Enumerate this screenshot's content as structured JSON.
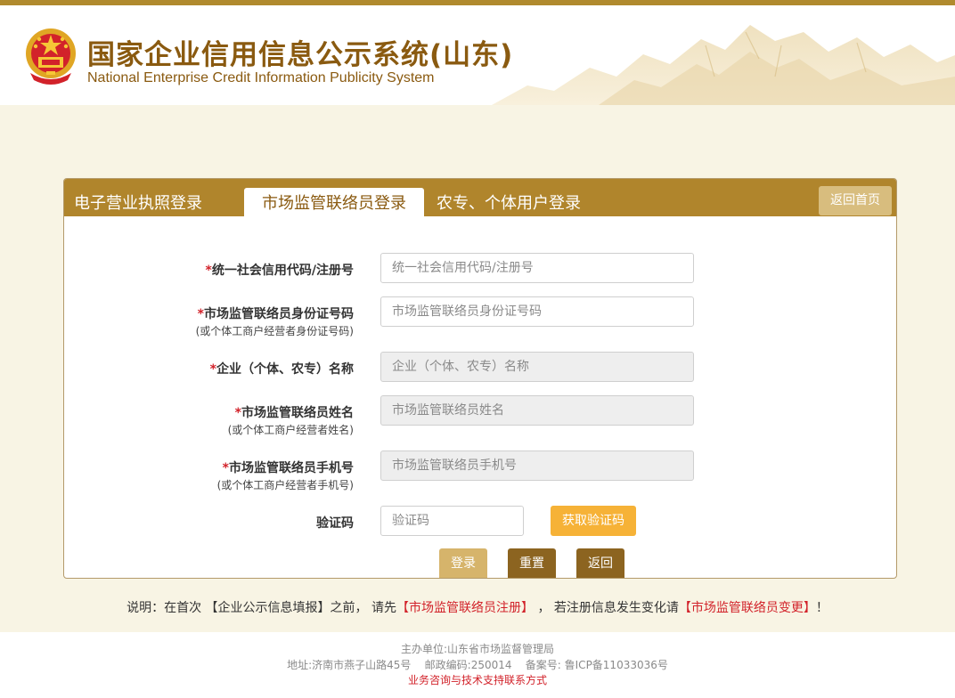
{
  "header": {
    "title": "国家企业信用信息公示系统(山东)",
    "subtitle": "National Enterprise Credit Information Publicity System"
  },
  "tabs": [
    {
      "label": "电子营业执照登录",
      "active": false
    },
    {
      "label": "市场监管联络员登录",
      "active": true
    },
    {
      "label": "农专、个体用户登录",
      "active": false
    }
  ],
  "home_button": "返回首页",
  "form": {
    "required_mark": "*",
    "fields": [
      {
        "label": "统一社会信用代码/注册号",
        "sub": "",
        "placeholder": "统一社会信用代码/注册号",
        "disabled": false
      },
      {
        "label": "市场监管联络员身份证号码",
        "sub": "(或个体工商户经营者身份证号码)",
        "placeholder": "市场监管联络员身份证号码",
        "disabled": false
      },
      {
        "label": "企业（个体、农专）名称",
        "sub": "",
        "placeholder": "企业（个体、农专）名称",
        "disabled": true
      },
      {
        "label": "市场监管联络员姓名",
        "sub": "(或个体工商户经营者姓名)",
        "placeholder": "市场监管联络员姓名",
        "disabled": true
      },
      {
        "label": "市场监管联络员手机号",
        "sub": "(或个体工商户经营者手机号)",
        "placeholder": "市场监管联络员手机号",
        "disabled": true
      }
    ],
    "captcha": {
      "label": "验证码",
      "placeholder": "验证码",
      "button": "获取验证码"
    }
  },
  "actions": {
    "login": "登录",
    "reset": "重置",
    "back": "返回"
  },
  "colors": {
    "brand": "#b0852c",
    "login_btn": "#d6b46b",
    "dark_btn": "#8c6420",
    "captcha_btn": "#f6b237",
    "required": "#d2222a"
  },
  "notice": {
    "prefix": "说明：在首次 【企业公示信息填报】之前， 请先",
    "link1": "【市场监管联络员注册】",
    "middle": " ， 若注册信息发生变化请",
    "link2": "【市场监管联络员变更】",
    "suffix": "！"
  },
  "footer": {
    "sponsor": "主办单位:山东省市场监督管理局",
    "address": "地址:济南市燕子山路45号    邮政编码:250014    备案号: 鲁ICP备11033036号",
    "support": "业务咨询与技术支持联系方式"
  }
}
